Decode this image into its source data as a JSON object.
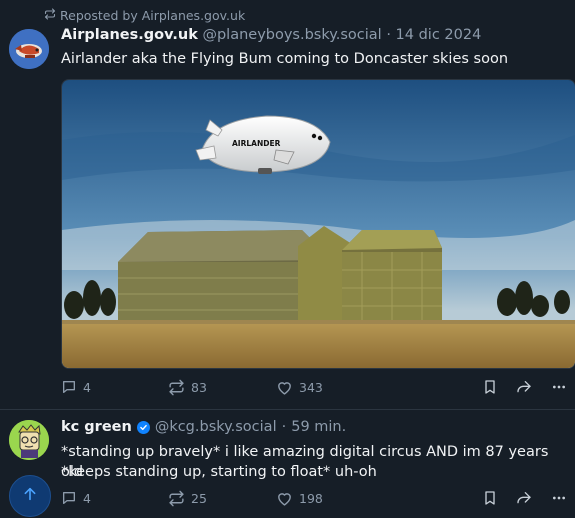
{
  "repost": {
    "label": "Reposted by Airplanes.gov.uk",
    "icon": "repost-icon"
  },
  "post1": {
    "display_name": "Airplanes.gov.uk",
    "handle": "@planeyboys.bsky.social",
    "separator": "·",
    "date": "14 dic 2024",
    "text": "Airlander aka the Flying Bum coming to Doncaster skies soon",
    "image": {
      "description_label": "AIRLANDER"
    },
    "actions": {
      "replies": "4",
      "reposts": "83",
      "likes": "343"
    }
  },
  "post2": {
    "display_name": "kc green",
    "handle": "@kcg.bsky.social",
    "separator": "·",
    "time": "59 min.",
    "text_line1": "*standing up bravely* i like amazing digital circus AND im 87 years old",
    "text_line2": "*keeps standing up, starting to float* uh-oh",
    "actions": {
      "replies": "4",
      "reposts": "25",
      "likes": "198"
    }
  },
  "colors": {
    "background": "#161e27",
    "muted": "#8d9bab",
    "accent": "#1083fe",
    "divider": "#2b3540"
  },
  "icons": [
    "repost-icon",
    "reply-icon",
    "like-icon",
    "bookmark-icon",
    "share-icon",
    "more-icon",
    "verified-icon",
    "arrow-up-icon"
  ]
}
